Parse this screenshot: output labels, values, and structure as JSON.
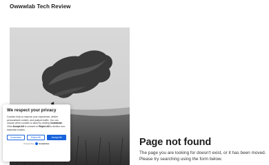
{
  "header": {
    "site_title": "Owwwlab Tech Review"
  },
  "not_found": {
    "title": "Page not found",
    "message": "The page you are looking for doesn't exist, or it has been moved. Please try searching using the form below."
  },
  "cookie_banner": {
    "title": "We respect your privacy",
    "text_before": "Cookies help us improve your experience, deliver personalized content, and analyze traffic. You can choose which cookies to allow by clicking ",
    "customize_word": "Customize",
    "text_middle": ". Click ",
    "accept_word": "Accept All",
    "text_middle2": " to consent or ",
    "reject_word": "Reject All",
    "text_after": " to decline non-essential cookies.",
    "customize_label": "Customize",
    "reject_label": "Reject All",
    "accept_label": "Accept All",
    "powered_by": "Powered by",
    "provider": "CookieYes"
  }
}
